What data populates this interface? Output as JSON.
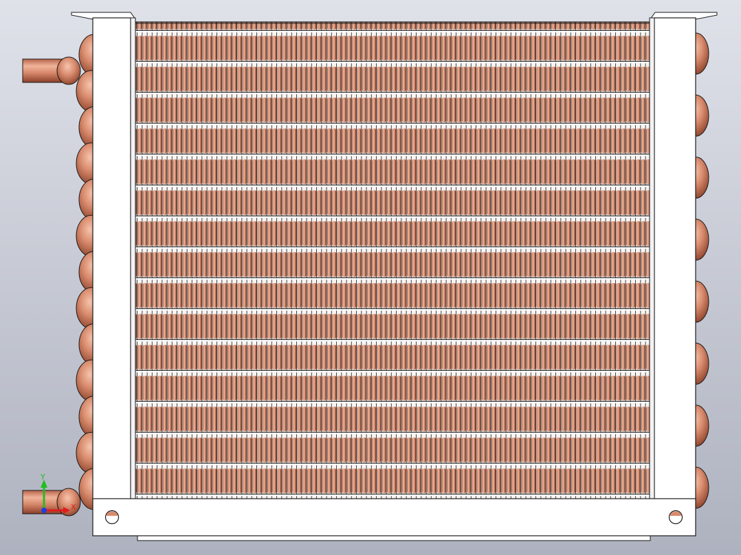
{
  "viewport": {
    "background_top": "#dfe2e9",
    "background_bottom": "#aeb2bf"
  },
  "model": {
    "part": "heat-exchanger-coil",
    "copper_color": "#d98c6e",
    "copper_shade": "#8a3f28",
    "frame_color": "#ffffff",
    "outline_color": "#1a1a1a",
    "fin_count": 104,
    "tube_rows": 16,
    "left_bends": 13,
    "right_bends": 8
  },
  "triad": {
    "y_label": "Y",
    "x_label": "X",
    "y_color": "#1fbf1f",
    "x_color": "#e01c1c",
    "z_color": "#1c3fe0"
  }
}
